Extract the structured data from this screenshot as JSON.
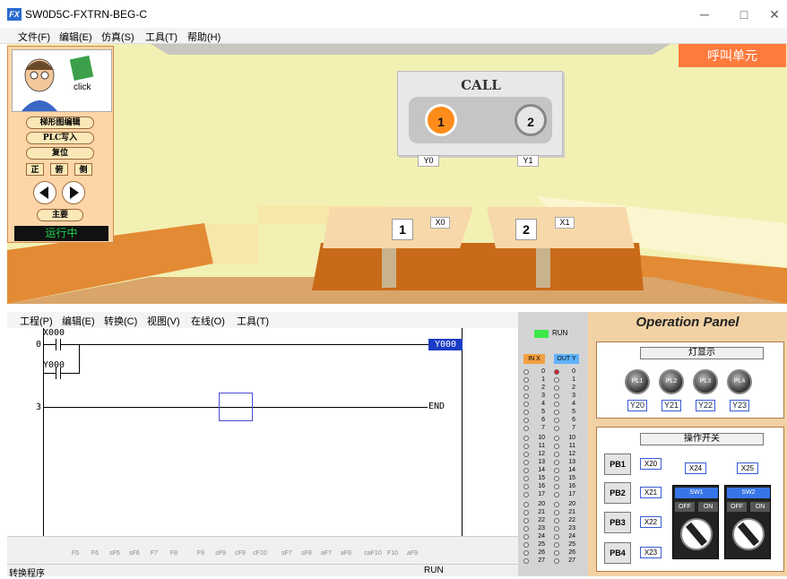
{
  "window": {
    "title": "SW0D5C-FXTRN-BEG-C",
    "app_icon": "FX",
    "minimize": "─",
    "maximize": "□",
    "close": "✕"
  },
  "menubar": [
    "文件(F)",
    "编辑(E)",
    "仿真(S)",
    "工具(T)",
    "帮助(H)"
  ],
  "scene": {
    "call_unit_label": "呼叫单元",
    "call_title": "CALL",
    "call_buttons": [
      {
        "label": "1",
        "output": "Y0",
        "lit": true
      },
      {
        "label": "2",
        "output": "Y1",
        "lit": false
      }
    ],
    "tables": [
      {
        "label": "1",
        "input": "X0"
      },
      {
        "label": "2",
        "input": "X1"
      }
    ]
  },
  "control_panel": {
    "click_label": "click",
    "buttons": [
      "梯形图编辑",
      "PLC写入",
      "复位"
    ],
    "view_buttons": [
      "正",
      "俯",
      "侧"
    ],
    "main_button": "主要",
    "status": "运行中"
  },
  "ladder_menubar": [
    "工程(P)",
    "编辑(E)",
    "转换(C)",
    "视图(V)",
    "在线(O)",
    "工具(T)"
  ],
  "ladder": {
    "rung_nums": [
      "0",
      "3"
    ],
    "contacts": [
      "X000",
      "Y000"
    ],
    "coil": "Y000",
    "end": "END"
  },
  "function_toolbar": [
    "F5",
    "F6",
    "sF5",
    "sF6",
    "F7",
    "F8",
    "F9",
    "sF9",
    "cF9",
    "cF10",
    "sF7",
    "sF8",
    "aF7",
    "aF8",
    "caF10",
    "F10",
    "aF9"
  ],
  "statusbar": {
    "left": "转换程序",
    "mode": "RUN"
  },
  "io_panel": {
    "run_label": "RUN",
    "in_header": "IN X",
    "out_header": "OUT Y",
    "rows_group1": [
      "0",
      "1",
      "2",
      "3",
      "4",
      "5",
      "6",
      "7"
    ],
    "rows_group2": [
      "10",
      "11",
      "12",
      "13",
      "14",
      "15",
      "16",
      "17"
    ],
    "rows_group3": [
      "20",
      "21",
      "22",
      "23",
      "24",
      "25",
      "26",
      "27"
    ],
    "y0_lit": true
  },
  "operation_panel": {
    "title": "Operation Panel",
    "lamp_section": "灯显示",
    "lamps": [
      {
        "label": "PL1",
        "output": "Y20"
      },
      {
        "label": "PL2",
        "output": "Y21"
      },
      {
        "label": "PL3",
        "output": "Y22"
      },
      {
        "label": "PL4",
        "output": "Y23"
      }
    ],
    "switch_section": "操作开关",
    "pushbuttons": [
      {
        "label": "PB1",
        "input": "X20"
      },
      {
        "label": "PB2",
        "input": "X21"
      },
      {
        "label": "PB3",
        "input": "X22"
      },
      {
        "label": "PB4",
        "input": "X23"
      }
    ],
    "switches": [
      {
        "name": "SW1",
        "input": "X24",
        "off": "OFF",
        "on": "ON"
      },
      {
        "name": "SW2",
        "input": "X25",
        "off": "OFF",
        "on": "ON"
      }
    ]
  },
  "colors": {
    "scene_wall": "#f3f0b3",
    "call_accent": "#ff7a3d",
    "button_lit": "#ff8c1a",
    "run_green": "#1fd14a",
    "panel_bg": "#fed5a7"
  }
}
